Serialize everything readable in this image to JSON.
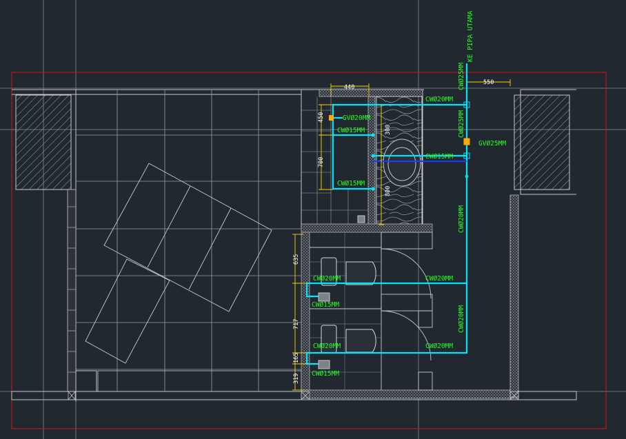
{
  "colors": {
    "background": "#212830",
    "grid": "#7b8087",
    "wall": "#c8c8c8",
    "border": "#d01818",
    "pipe_cw": "#00e5ff",
    "pipe_hot": "#1a3cff",
    "label": "#22ff22",
    "dimension": "#ffd400",
    "valve": "#ffaa00"
  },
  "labels": {
    "main_riser": "KE PIPA UTAMA",
    "riser_top": "CWØ25MM",
    "riser_mid": "CWØ25MM",
    "gate_valve": "GVØ25MM",
    "branch_top": "CWØ20MM",
    "sink_valve": "GVØ20MM",
    "sink_15_a": "CWØ15MM",
    "sink_15_b": "CWØ15MM",
    "mirror_15": "CWØ15MM",
    "riser_20_upper": "CWØ20MM",
    "riser_20_lower": "CWØ20MM",
    "wc1_20": "CWØ20MM",
    "wc1_15": "CWØ15MM",
    "wc1_branch": "CWØ20MM",
    "wc2_20": "CWØ20MM",
    "wc2_15": "CWØ15MM",
    "wc2_branch": "CWØ20MM"
  },
  "dimensions": {
    "d440": "440",
    "d550": "550",
    "d450": "450",
    "d700": "700",
    "d300": "300",
    "d800": "800",
    "d635": "635",
    "d717": "717",
    "d165": "165",
    "d319": "319"
  }
}
